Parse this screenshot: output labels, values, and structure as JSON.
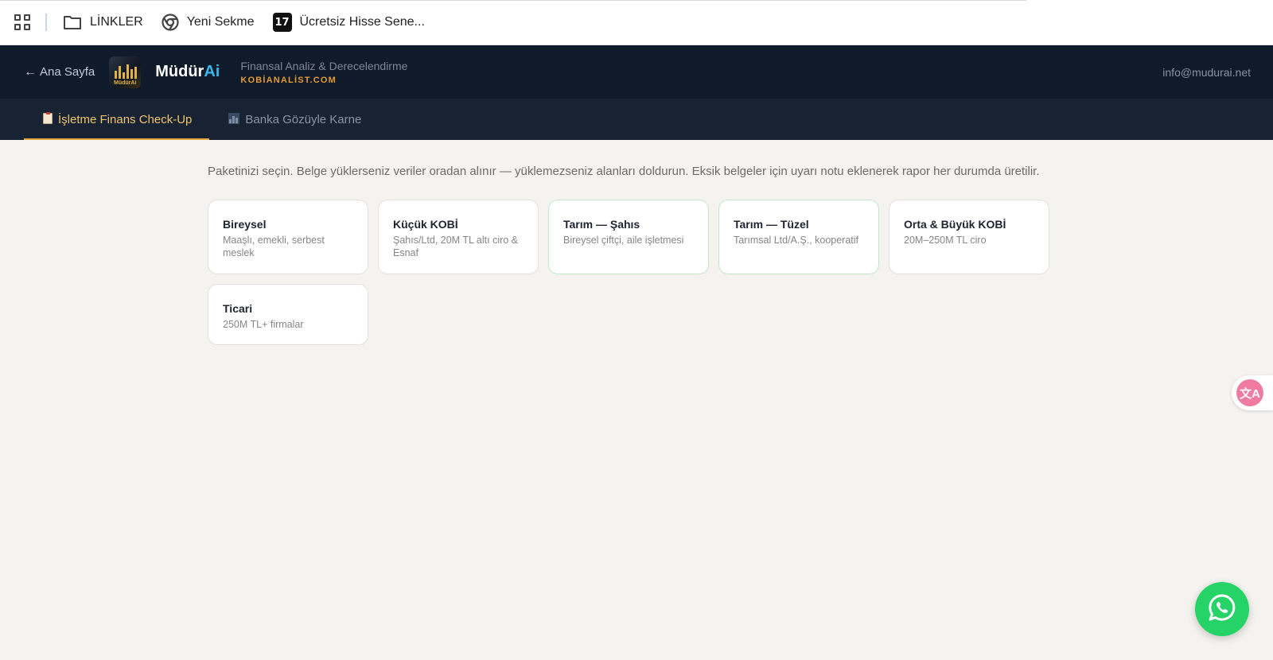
{
  "bookmarks": {
    "items": [
      {
        "label": "LİNKLER",
        "icon": "folder-icon"
      },
      {
        "label": "Yeni Sekme",
        "icon": "chrome-icon"
      },
      {
        "label": "Ücretsiz Hisse Sene...",
        "icon": "tradingview-icon"
      }
    ],
    "tv_glyph": "17"
  },
  "header": {
    "back_arrow": "←",
    "back_label": "Ana Sayfa",
    "logo_text": "MüdürAi",
    "brand_main": "Müdür",
    "brand_accent": "Ai",
    "tagline": "Finansal Analiz & Derecelendirme",
    "site": "KOBİANALİST.COM",
    "contact": "info@mudurai.net"
  },
  "tabs": [
    {
      "label": "İşletme Finans Check-Up",
      "icon": "clipboard-icon",
      "active": true
    },
    {
      "label": "Banka Gözüyle Karne",
      "icon": "bar-chart-icon",
      "active": false
    }
  ],
  "main": {
    "intro": "Paketinizi seçin. Belge yüklerseniz veriler oradan alınır — yüklemezseniz alanları doldurun. Eksik belgeler için uyarı notu eklenerek rapor her durumda üretilir.",
    "packages": [
      {
        "title": "Bireysel",
        "desc": "Maaşlı, emekli, serbest meslek"
      },
      {
        "title": "Küçük KOBİ",
        "desc": "Şahıs/Ltd, 20M TL altı ciro & Esnaf"
      },
      {
        "title": "Tarım — Şahıs",
        "desc": "Bireysel çiftçi, aile işletmesi"
      },
      {
        "title": "Tarım — Tüzel",
        "desc": "Tarımsal Ltd/A.Ş., kooperatif"
      },
      {
        "title": "Orta & Büyük KOBİ",
        "desc": "20M–250M TL ciro"
      },
      {
        "title": "Ticari",
        "desc": "250M TL+ firmalar"
      }
    ]
  },
  "floating": {
    "translate_glyph": "文A",
    "whatsapp_icon": "whatsapp-icon"
  },
  "colors": {
    "header_bg": "#0f1a2b",
    "tabs_bg": "#172233",
    "accent": "#f2c46b",
    "brand_accent": "#38b6e8",
    "site_accent": "#e39b2f",
    "whatsapp": "#25d366",
    "page_bg": "#f4f3ef"
  }
}
